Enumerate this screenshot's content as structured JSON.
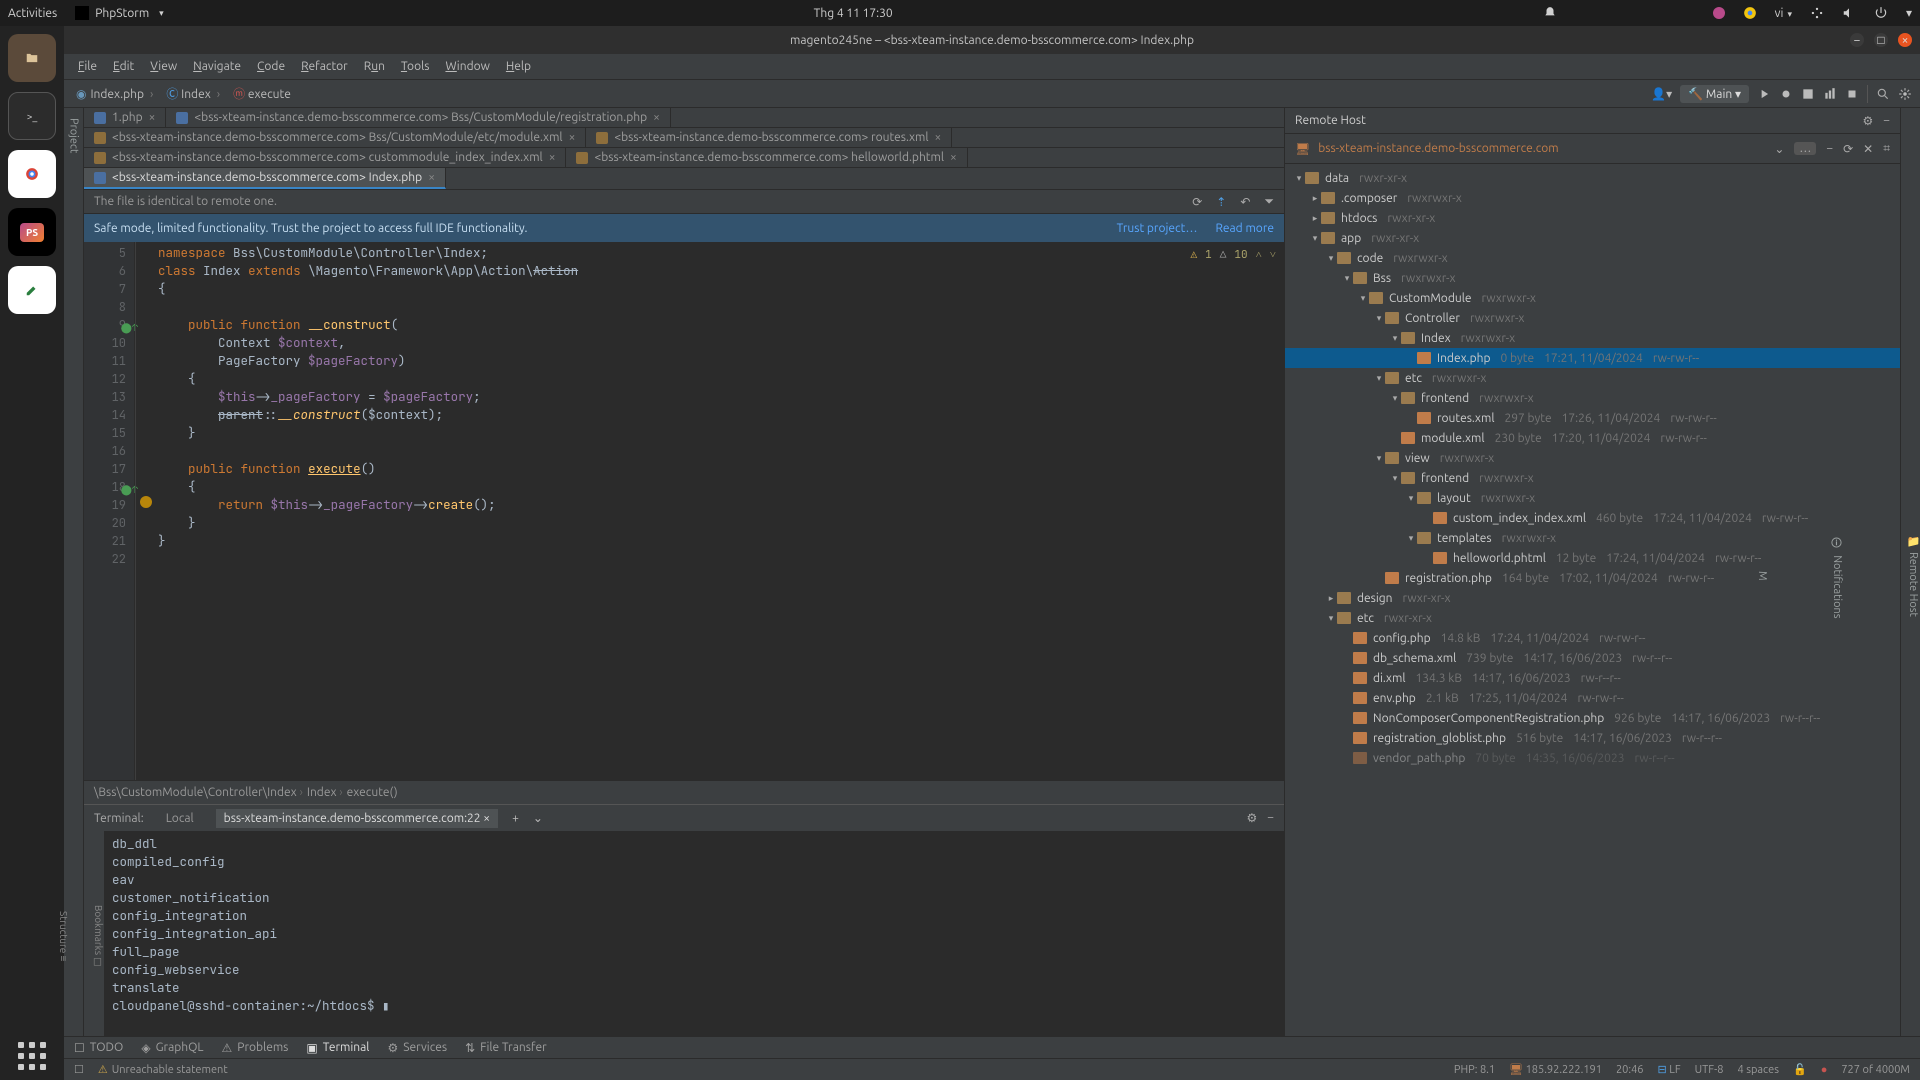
{
  "ubuntu": {
    "activities": "Activities",
    "app": "PhpStorm",
    "clock": "Thg 4 11  17:30",
    "lang": "vi"
  },
  "window": {
    "title": "magento245ne – <bss-xteam-instance.demo-bsscommerce.com> Index.php"
  },
  "menu": [
    "File",
    "Edit",
    "View",
    "Navigate",
    "Code",
    "Refactor",
    "Run",
    "Tools",
    "Window",
    "Help"
  ],
  "navcrumb": [
    {
      "icon": "php",
      "label": "Index.php"
    },
    {
      "icon": "class",
      "label": "Index"
    },
    {
      "icon": "method",
      "label": "execute"
    }
  ],
  "runconfig": "Main",
  "tabs": [
    [
      {
        "icon": "php",
        "label": "1.php"
      },
      {
        "icon": "php",
        "label": "<bss-xteam-instance.demo-bsscommerce.com> Bss/CustomModule/registration.php"
      }
    ],
    [
      {
        "icon": "xml",
        "label": "<bss-xteam-instance.demo-bsscommerce.com> Bss/CustomModule/etc/module.xml"
      },
      {
        "icon": "xml",
        "label": "<bss-xteam-instance.demo-bsscommerce.com> routes.xml"
      }
    ],
    [
      {
        "icon": "xml",
        "label": "<bss-xteam-instance.demo-bsscommerce.com> custommodule_index_index.xml"
      },
      {
        "icon": "xml",
        "label": "<bss-xteam-instance.demo-bsscommerce.com> helloworld.phtml"
      }
    ],
    [
      {
        "icon": "php",
        "label": "<bss-xteam-instance.demo-bsscommerce.com> Index.php",
        "active": true
      }
    ]
  ],
  "file_msg": "The file is identical to remote one.",
  "safemode": {
    "msg": "Safe mode, limited functionality. Trust the project to access full IDE functionality.",
    "trust": "Trust project…",
    "readmore": "Read more"
  },
  "code_lines": [
    5,
    6,
    7,
    8,
    9,
    10,
    11,
    12,
    13,
    14,
    15,
    16,
    17,
    18,
    19,
    20,
    21,
    22
  ],
  "inspection": {
    "err": "1",
    "warn": "10"
  },
  "code_breadcrumb": [
    "\\Bss\\CustomModule\\Controller\\Index",
    "Index",
    "execute()"
  ],
  "terminal": {
    "title": "Terminal:",
    "local": "Local",
    "remote": "bss-xteam-instance.demo-bsscommerce.com:22",
    "lines": [
      "db_ddl",
      "compiled_config",
      "eav",
      "customer_notification",
      "config_integration",
      "config_integration_api",
      "full_page",
      "config_webservice",
      "translate"
    ],
    "prompt": "cloudpanel@sshd-container:~/htdocs$ ▮"
  },
  "bottom_tabs": [
    {
      "icon": "todo",
      "label": "TODO"
    },
    {
      "icon": "graphql",
      "label": "GraphQL"
    },
    {
      "icon": "problems",
      "label": "Problems"
    },
    {
      "icon": "terminal",
      "label": "Terminal",
      "active": true
    },
    {
      "icon": "services",
      "label": "Services"
    },
    {
      "icon": "filetransfer",
      "label": "File Transfer"
    }
  ],
  "status": {
    "msg": "Unreachable statement",
    "php": "PHP: 8.1",
    "ip": "185.92.222.191",
    "caret": "20:46",
    "le": "LF",
    "enc": "UTF-8",
    "indent": "4 spaces",
    "mem": "727 of 4000M"
  },
  "remote": {
    "title": "Remote Host",
    "host": "bss-xteam-instance.demo-bsscommerce.com"
  },
  "tree": [
    {
      "d": 0,
      "a": "v",
      "t": "fold",
      "name": "data",
      "perm": "rwxr-xr-x"
    },
    {
      "d": 1,
      "a": ">",
      "t": "fold",
      "name": ".composer",
      "perm": "rwxrwxr-x"
    },
    {
      "d": 1,
      "a": ">",
      "t": "fold",
      "name": "htdocs",
      "perm": "rwxr-xr-x"
    },
    {
      "d": 1,
      "a": "v",
      "t": "fold",
      "name": "app",
      "perm": "rwxr-xr-x"
    },
    {
      "d": 2,
      "a": "v",
      "t": "fold",
      "name": "code",
      "perm": "rwxrwxr-x"
    },
    {
      "d": 3,
      "a": "v",
      "t": "fold",
      "name": "Bss",
      "perm": "rwxrwxr-x"
    },
    {
      "d": 4,
      "a": "v",
      "t": "fold",
      "name": "CustomModule",
      "perm": "rwxrwxr-x"
    },
    {
      "d": 5,
      "a": "v",
      "t": "fold",
      "name": "Controller",
      "perm": "rwxrwxr-x"
    },
    {
      "d": 6,
      "a": "v",
      "t": "fold",
      "name": "Index",
      "perm": "rwxrwxr-x"
    },
    {
      "d": 7,
      "a": "",
      "t": "file-o",
      "name": "Index.php",
      "size": "0 byte",
      "date": "17:21, 11/04/2024",
      "perm": "rw-rw-r--",
      "sel": true
    },
    {
      "d": 5,
      "a": "v",
      "t": "fold",
      "name": "etc",
      "perm": "rwxrwxr-x"
    },
    {
      "d": 6,
      "a": "v",
      "t": "fold",
      "name": "frontend",
      "perm": "rwxrwxr-x"
    },
    {
      "d": 7,
      "a": "",
      "t": "file-o",
      "name": "routes.xml",
      "size": "297 byte",
      "date": "17:26, 11/04/2024",
      "perm": "rw-rw-r--"
    },
    {
      "d": 6,
      "a": "",
      "t": "file-o",
      "name": "module.xml",
      "size": "230 byte",
      "date": "17:20, 11/04/2024",
      "perm": "rw-rw-r--"
    },
    {
      "d": 5,
      "a": "v",
      "t": "fold",
      "name": "view",
      "perm": "rwxrwxr-x"
    },
    {
      "d": 6,
      "a": "v",
      "t": "fold",
      "name": "frontend",
      "perm": "rwxrwxr-x"
    },
    {
      "d": 7,
      "a": "v",
      "t": "fold",
      "name": "layout",
      "perm": "rwxrwxr-x"
    },
    {
      "d": 8,
      "a": "",
      "t": "file-o",
      "name": "custom_index_index.xml",
      "size": "460 byte",
      "date": "17:24, 11/04/2024",
      "perm": "rw-rw-r--"
    },
    {
      "d": 7,
      "a": "v",
      "t": "fold",
      "name": "templates",
      "perm": "rwxrwxr-x"
    },
    {
      "d": 8,
      "a": "",
      "t": "file-o",
      "name": "helloworld.phtml",
      "size": "12 byte",
      "date": "17:24, 11/04/2024",
      "perm": "rw-rw-r--"
    },
    {
      "d": 5,
      "a": "",
      "t": "file-o",
      "name": "registration.php",
      "size": "164 byte",
      "date": "17:02, 11/04/2024",
      "perm": "rw-rw-r--"
    },
    {
      "d": 2,
      "a": ">",
      "t": "fold",
      "name": "design",
      "perm": "rwxr-xr-x"
    },
    {
      "d": 2,
      "a": "v",
      "t": "fold",
      "name": "etc",
      "perm": "rwxr-xr-x"
    },
    {
      "d": 3,
      "a": "",
      "t": "file-o",
      "name": "config.php",
      "size": "14.8 kB",
      "date": "17:24, 11/04/2024",
      "perm": "rw-rw-r--"
    },
    {
      "d": 3,
      "a": "",
      "t": "file-o",
      "name": "db_schema.xml",
      "size": "739 byte",
      "date": "14:17, 16/06/2023",
      "perm": "rw-r--r--"
    },
    {
      "d": 3,
      "a": "",
      "t": "file-o",
      "name": "di.xml",
      "size": "134.3 kB",
      "date": "14:17, 16/06/2023",
      "perm": "rw-r--r--"
    },
    {
      "d": 3,
      "a": "",
      "t": "file-o",
      "name": "env.php",
      "size": "2.1 kB",
      "date": "17:25, 11/04/2024",
      "perm": "rw-rw-r--"
    },
    {
      "d": 3,
      "a": "",
      "t": "file-o",
      "name": "NonComposerComponentRegistration.php",
      "size": "926 byte",
      "date": "14:17, 16/06/2023",
      "perm": "rw-r--r--"
    },
    {
      "d": 3,
      "a": "",
      "t": "file-o",
      "name": "registration_globlist.php",
      "size": "516 byte",
      "date": "14:17, 16/06/2023",
      "perm": "rw-r--r--"
    },
    {
      "d": 3,
      "a": "",
      "t": "file-o",
      "name": "vendor_path.php",
      "size": "70 byte",
      "date": "14:35, 16/06/2023",
      "perm": "rw-r--r--",
      "faded": true
    }
  ]
}
